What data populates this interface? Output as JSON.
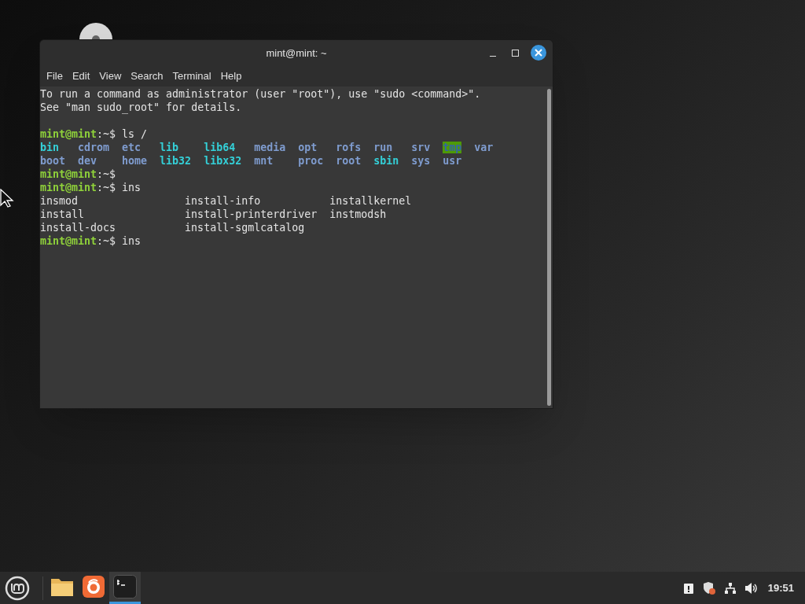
{
  "window": {
    "title": "mint@mint: ~"
  },
  "menu": [
    "File",
    "Edit",
    "View",
    "Search",
    "Terminal",
    "Help"
  ],
  "terminal": {
    "lines": [
      {
        "kind": "text",
        "text": "To run a command as administrator (user \"root\"), use \"sudo <command>\"."
      },
      {
        "kind": "text",
        "text": "See \"man sudo_root\" for details."
      },
      {
        "kind": "blank"
      },
      {
        "kind": "prompt",
        "prompt": "mint@mint",
        "rest": ":~$ ls /"
      },
      {
        "kind": "listing",
        "entries": [
          {
            "name": "bin",
            "color": "#34d0d8",
            "highlighted": false
          },
          {
            "name": "cdrom",
            "color": "#7f9ccf",
            "highlighted": false
          },
          {
            "name": "etc",
            "color": "#7f9ccf",
            "highlighted": false
          },
          {
            "name": "lib",
            "color": "#34d0d8",
            "highlighted": false
          },
          {
            "name": "lib64",
            "color": "#34d0d8",
            "highlighted": false
          },
          {
            "name": "media",
            "color": "#7f9ccf",
            "highlighted": false
          },
          {
            "name": "opt",
            "color": "#7f9ccf",
            "highlighted": false
          },
          {
            "name": "rofs",
            "color": "#7f9ccf",
            "highlighted": false
          },
          {
            "name": "run",
            "color": "#7f9ccf",
            "highlighted": false
          },
          {
            "name": "srv",
            "color": "#7f9ccf",
            "highlighted": false
          },
          {
            "name": "tmp",
            "color": "#4e9a06",
            "highlighted": true
          },
          {
            "name": "var",
            "color": "#7f9ccf",
            "highlighted": false
          }
        ]
      },
      {
        "kind": "listing",
        "entries": [
          {
            "name": "boot",
            "color": "#7f9ccf",
            "highlighted": false
          },
          {
            "name": "dev",
            "color": "#7f9ccf",
            "highlighted": false
          },
          {
            "name": "home",
            "color": "#7f9ccf",
            "highlighted": false
          },
          {
            "name": "lib32",
            "color": "#34d0d8",
            "highlighted": false
          },
          {
            "name": "libx32",
            "color": "#34d0d8",
            "highlighted": false
          },
          {
            "name": "mnt",
            "color": "#7f9ccf",
            "highlighted": false
          },
          {
            "name": "proc",
            "color": "#7f9ccf",
            "highlighted": false
          },
          {
            "name": "root",
            "color": "#7f9ccf",
            "highlighted": false
          },
          {
            "name": "sbin",
            "color": "#34d0d8",
            "highlighted": false
          },
          {
            "name": "sys",
            "color": "#7f9ccf",
            "highlighted": false
          },
          {
            "name": "usr",
            "color": "#7f9ccf",
            "highlighted": false
          }
        ]
      },
      {
        "kind": "prompt",
        "prompt": "mint@mint",
        "rest": ":~$"
      },
      {
        "kind": "prompt",
        "prompt": "mint@mint",
        "rest": ":~$ ins"
      },
      {
        "kind": "completions",
        "entries": [
          "insmod",
          "install-info",
          "installkernel"
        ]
      },
      {
        "kind": "completions",
        "entries": [
          "install",
          "install-printerdriver",
          "instmodsh"
        ]
      },
      {
        "kind": "completions",
        "entries": [
          "install-docs",
          "install-sgmlcatalog"
        ]
      },
      {
        "kind": "prompt",
        "prompt": "mint@mint",
        "rest": ":~$ ins"
      }
    ]
  },
  "taskbar": {
    "apps": [
      {
        "kind": "files",
        "selected": false
      },
      {
        "kind": "browser",
        "selected": false
      },
      {
        "kind": "terminal",
        "selected": true
      }
    ],
    "clock": "19:51"
  }
}
